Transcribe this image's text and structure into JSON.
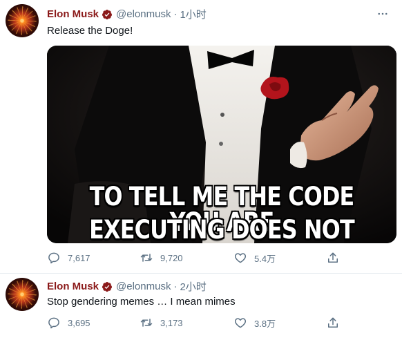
{
  "tweets": [
    {
      "author": {
        "name": "Elon Musk",
        "handle": "@elonmusk"
      },
      "time": "1小时",
      "text": "Release the Doge!",
      "media": {
        "caption_line1": "TO TELL ME THE CODE YOU ARE",
        "caption_line2": "EXECUTING DOES NOT COMPILE"
      },
      "stats": {
        "replies": "7,617",
        "retweets": "9,720",
        "likes": "5.4万"
      }
    },
    {
      "author": {
        "name": "Elon Musk",
        "handle": "@elonmusk"
      },
      "time": "2小时",
      "text": "Stop gendering memes … I mean mimes",
      "stats": {
        "replies": "3,695",
        "retweets": "3,173",
        "likes": "3.8万"
      }
    }
  ],
  "icons": {
    "verified": "verified-badge-icon",
    "more": "more-options-icon",
    "reply": "reply-icon",
    "retweet": "retweet-icon",
    "like": "like-icon",
    "share": "share-icon"
  },
  "colors": {
    "name": "#8b1a1a",
    "secondary_text": "#5b7083",
    "verified": "#8b1a1a",
    "divider": "#e6ecf0"
  }
}
